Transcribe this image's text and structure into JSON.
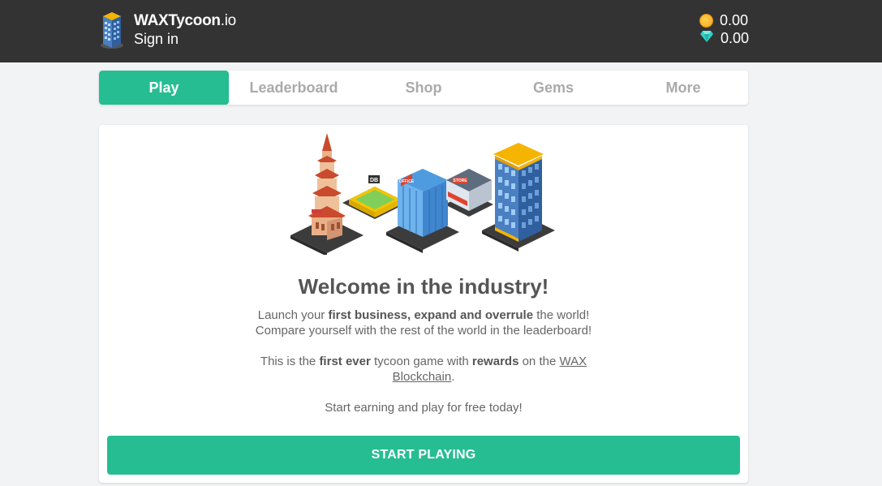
{
  "header": {
    "brand_bold": "WAXTycoon",
    "brand_suffix": ".io",
    "signin_label": "Sign in",
    "coins_value": "0.00",
    "gems_value": "0.00",
    "icons": {
      "logo": "building-logo-icon",
      "coins": "coin-icon",
      "gems": "diamond-icon"
    }
  },
  "tabs": [
    {
      "label": "Play",
      "active": true
    },
    {
      "label": "Leaderboard",
      "active": false
    },
    {
      "label": "Shop",
      "active": false
    },
    {
      "label": "Gems",
      "active": false
    },
    {
      "label": "More",
      "active": false
    }
  ],
  "main": {
    "headline": "Welcome in the industry!",
    "p1": {
      "t1": "Launch your ",
      "b1": "first business, expand and overrule",
      "t2": " the world!",
      "line2": "Compare yourself with the rest of the world in the leaderboard!"
    },
    "p2": {
      "t1": "This is the ",
      "b1": "first ever",
      "t2": " tycoon game with ",
      "b2": "rewards",
      "t3": " on the ",
      "link": "WAX",
      "link2": "Blockchain",
      "t4": "."
    },
    "p3": "Start earning and play for free today!",
    "cta_label": "START PLAYING",
    "illustration_labels": {
      "office": "OFFICE",
      "store": "STORE",
      "sign": "DB"
    }
  },
  "colors": {
    "topbar": "#333333",
    "accent": "#26bd92",
    "background": "#f1f3f5",
    "text": "#555555",
    "coin": "#f5a623",
    "gem": "#34d1c4"
  }
}
